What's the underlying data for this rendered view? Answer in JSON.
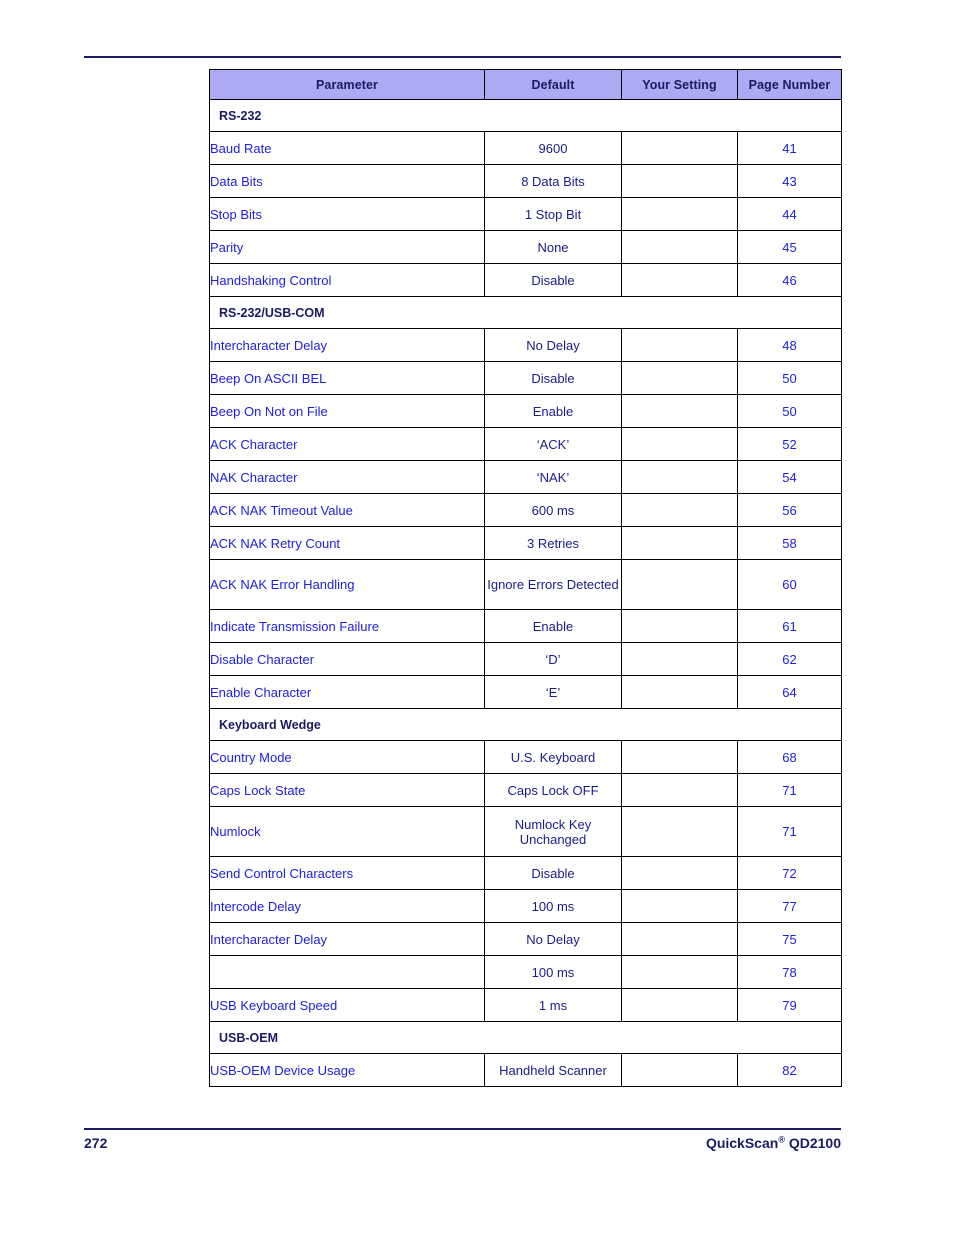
{
  "document": {
    "footer": {
      "page_number": "272",
      "product_name": "QuickScan",
      "trademark": "®",
      "model": " QD2100"
    }
  },
  "table": {
    "columns": [
      {
        "label": "Parameter"
      },
      {
        "label": "Default"
      },
      {
        "label": "Your Setting"
      },
      {
        "label": "Page Number"
      }
    ],
    "rows": [
      {
        "kind": "section",
        "label": "RS-232"
      },
      {
        "kind": "data",
        "parameter": "Baud Rate",
        "default": "9600",
        "your_setting": "",
        "page": "41"
      },
      {
        "kind": "data",
        "parameter": "Data Bits",
        "default": "8 Data Bits",
        "your_setting": "",
        "page": "43"
      },
      {
        "kind": "data",
        "parameter": "Stop Bits",
        "default": "1 Stop Bit",
        "your_setting": "",
        "page": "44"
      },
      {
        "kind": "data",
        "parameter": "Parity",
        "default": "None",
        "your_setting": "",
        "page": "45"
      },
      {
        "kind": "data",
        "parameter": "Handshaking Control",
        "default": "Disable",
        "your_setting": "",
        "page": "46"
      },
      {
        "kind": "section",
        "label": "RS-232/USB-COM"
      },
      {
        "kind": "data",
        "parameter": "Intercharacter Delay",
        "default": "No Delay",
        "your_setting": "",
        "page": "48"
      },
      {
        "kind": "data",
        "parameter": "Beep On ASCII BEL",
        "default": "Disable",
        "your_setting": "",
        "page": "50"
      },
      {
        "kind": "data",
        "parameter": "Beep On Not on File",
        "default": "Enable",
        "your_setting": "",
        "page": "50"
      },
      {
        "kind": "data",
        "parameter": "ACK Character",
        "default": "‘ACK’",
        "your_setting": "",
        "page": "52"
      },
      {
        "kind": "data",
        "parameter": "NAK Character",
        "default": "‘NAK’",
        "your_setting": "",
        "page": "54"
      },
      {
        "kind": "data",
        "parameter": "ACK NAK Timeout Value",
        "default": "600 ms",
        "your_setting": "",
        "page": "56"
      },
      {
        "kind": "data",
        "parameter": "ACK NAK Retry Count",
        "default": "3 Retries",
        "your_setting": "",
        "page": "58"
      },
      {
        "kind": "data",
        "tall": true,
        "parameter": "ACK NAK Error Handling",
        "default": "Ignore Errors Detected",
        "your_setting": "",
        "page": "60"
      },
      {
        "kind": "data",
        "parameter": "Indicate Transmission Failure",
        "default": "Enable",
        "your_setting": "",
        "page": "61"
      },
      {
        "kind": "data",
        "parameter": "Disable Character",
        "default": "‘D’",
        "your_setting": "",
        "page": "62"
      },
      {
        "kind": "data",
        "parameter": "Enable Character",
        "default": "‘E’",
        "your_setting": "",
        "page": "64"
      },
      {
        "kind": "section",
        "label": "Keyboard Wedge"
      },
      {
        "kind": "data",
        "parameter": "Country Mode",
        "default": "U.S. Keyboard",
        "your_setting": "",
        "page": "68"
      },
      {
        "kind": "data",
        "parameter": "Caps Lock State",
        "default": "Caps Lock OFF",
        "your_setting": "",
        "page": "71"
      },
      {
        "kind": "data",
        "tall": true,
        "parameter": "Numlock",
        "default": "Numlock Key Unchanged",
        "your_setting": "",
        "page": "71"
      },
      {
        "kind": "data",
        "parameter": "Send Control Characters",
        "default": "Disable",
        "your_setting": "",
        "page": "72"
      },
      {
        "kind": "data",
        "parameter": "Intercode Delay",
        "default": "100 ms",
        "your_setting": "",
        "page": "77"
      },
      {
        "kind": "data",
        "parameter": "Intercharacter Delay",
        "default": "No Delay",
        "your_setting": "",
        "page": "75"
      },
      {
        "kind": "data",
        "parameter": "",
        "default": "100 ms",
        "your_setting": "",
        "page": "78"
      },
      {
        "kind": "data",
        "parameter": "USB Keyboard Speed",
        "default": "1 ms",
        "your_setting": "",
        "page": "79"
      },
      {
        "kind": "section",
        "label": "USB-OEM"
      },
      {
        "kind": "data",
        "parameter": "USB-OEM Device Usage",
        "default": "Handheld Scanner",
        "your_setting": "",
        "page": "82"
      }
    ]
  },
  "colors": {
    "header_bg": "#aaaaf5",
    "header_text": "#1b1b64",
    "link_text": "#2020e0",
    "value_text": "#1b1b8c",
    "rule": "#1b1b64"
  }
}
